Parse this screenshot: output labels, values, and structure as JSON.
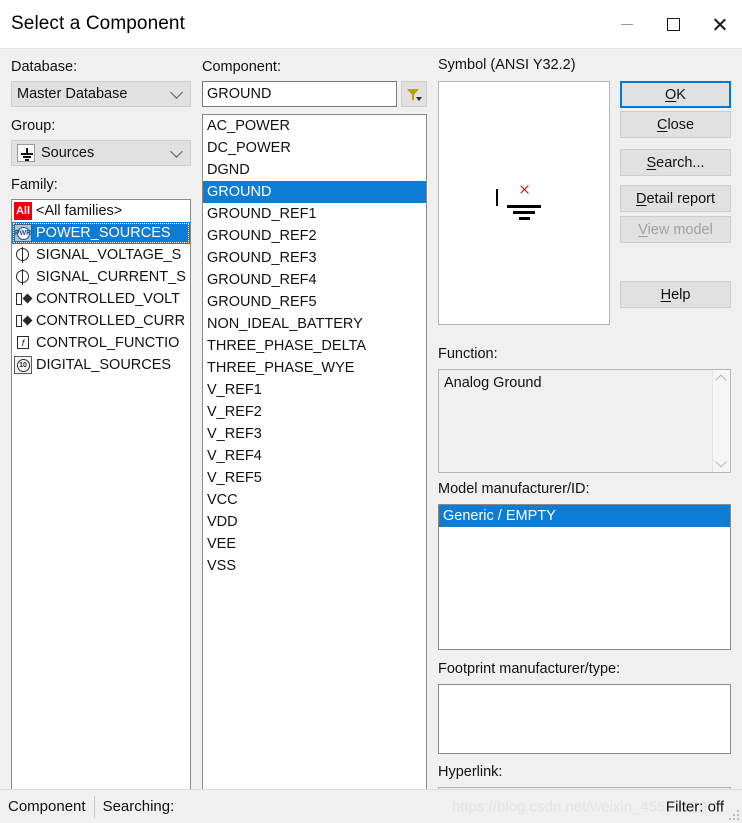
{
  "window": {
    "title": "Select a Component",
    "controls": {
      "minimize": "minimize-icon",
      "maximize": "maximize-icon",
      "close": "close-icon"
    }
  },
  "left_panel": {
    "database_label": "Database:",
    "database_value": "Master Database",
    "group_label": "Group:",
    "group_value": "Sources",
    "group_icon": "ground-symbol-icon",
    "family_label": "Family:",
    "family_items": [
      {
        "label": "<All families>",
        "icon": "all-families-icon",
        "selected": false
      },
      {
        "label": "POWER_SOURCES",
        "icon": "power-sources-icon",
        "selected": true
      },
      {
        "label": "SIGNAL_VOLTAGE_S",
        "icon": "signal-voltage-source-icon",
        "selected": false
      },
      {
        "label": "SIGNAL_CURRENT_S",
        "icon": "signal-current-source-icon",
        "selected": false
      },
      {
        "label": "CONTROLLED_VOLT",
        "icon": "controlled-voltage-source-icon",
        "selected": false
      },
      {
        "label": "CONTROLLED_CURR",
        "icon": "controlled-current-source-icon",
        "selected": false
      },
      {
        "label": "CONTROL_FUNCTIO",
        "icon": "control-function-icon",
        "selected": false
      },
      {
        "label": "DIGITAL_SOURCES",
        "icon": "digital-sources-icon",
        "selected": false
      }
    ],
    "scroll_left": "‹",
    "scroll_right": "›"
  },
  "component_panel": {
    "label": "Component:",
    "search_value": "GROUND",
    "filter_icon": "filter-funnel-icon",
    "items": [
      {
        "label": "AC_POWER",
        "selected": false
      },
      {
        "label": "DC_POWER",
        "selected": false
      },
      {
        "label": "DGND",
        "selected": false
      },
      {
        "label": "GROUND",
        "selected": true
      },
      {
        "label": "GROUND_REF1",
        "selected": false
      },
      {
        "label": "GROUND_REF2",
        "selected": false
      },
      {
        "label": "GROUND_REF3",
        "selected": false
      },
      {
        "label": "GROUND_REF4",
        "selected": false
      },
      {
        "label": "GROUND_REF5",
        "selected": false
      },
      {
        "label": "NON_IDEAL_BATTERY",
        "selected": false
      },
      {
        "label": "THREE_PHASE_DELTA",
        "selected": false
      },
      {
        "label": "THREE_PHASE_WYE",
        "selected": false
      },
      {
        "label": "V_REF1",
        "selected": false
      },
      {
        "label": "V_REF2",
        "selected": false
      },
      {
        "label": "V_REF3",
        "selected": false
      },
      {
        "label": "V_REF4",
        "selected": false
      },
      {
        "label": "V_REF5",
        "selected": false
      },
      {
        "label": "VCC",
        "selected": false
      },
      {
        "label": "VDD",
        "selected": false
      },
      {
        "label": "VEE",
        "selected": false
      },
      {
        "label": "VSS",
        "selected": false
      }
    ]
  },
  "symbol_panel": {
    "label": "Symbol (ANSI Y32.2)",
    "symbol_icon": "ground-symbol-graphic"
  },
  "details": {
    "function_label": "Function:",
    "function_value": "Analog Ground",
    "model_label": "Model manufacturer/ID:",
    "model_value": "Generic / EMPTY",
    "footprint_label": "Footprint manufacturer/type:",
    "footprint_value": "",
    "hyperlink_label": "Hyperlink:",
    "hyperlink_value": ""
  },
  "buttons": {
    "ok": {
      "pre": "",
      "accel": "O",
      "post": "K",
      "default": true,
      "disabled": false
    },
    "close": {
      "pre": "",
      "accel": "C",
      "post": "lose",
      "default": false,
      "disabled": false
    },
    "search": {
      "pre": "",
      "accel": "S",
      "post": "earch...",
      "default": false,
      "disabled": false
    },
    "detail_report": {
      "pre": "",
      "accel": "D",
      "post": "etail report",
      "default": false,
      "disabled": false
    },
    "view_model": {
      "pre": "",
      "accel": "V",
      "post": "iew model",
      "default": false,
      "disabled": true
    },
    "help": {
      "pre": "",
      "accel": "H",
      "post": "elp",
      "default": false,
      "disabled": false
    }
  },
  "statusbar": {
    "segment_1": "Component",
    "segment_2": "Searching:",
    "filter_status": "Filter: off",
    "watermark": "https://blog.csdn.net/weixin_45503929"
  },
  "colors": {
    "selection_blue": "#0c7cd5",
    "window_bg": "#f0f0f0",
    "accent_border": "#0078d7",
    "all_badge_red": "#e8000b",
    "symbol_terminal_red": "#cc0000"
  }
}
